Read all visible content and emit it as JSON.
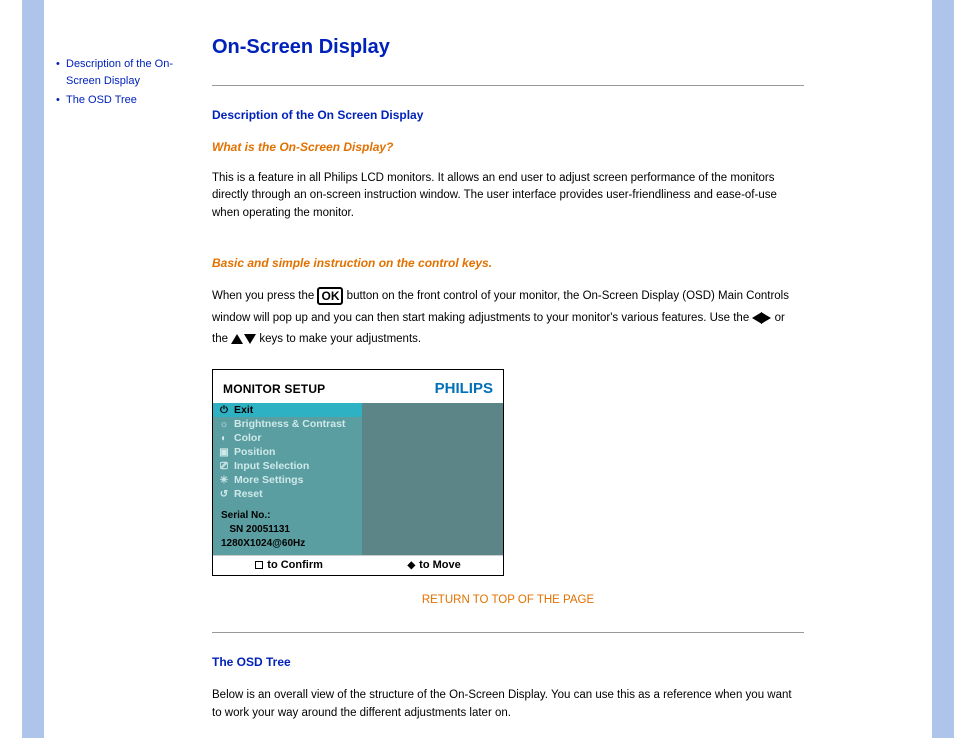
{
  "sidebar": {
    "items": [
      {
        "label": "Description of the On-Screen Display"
      },
      {
        "label": "The OSD Tree"
      }
    ]
  },
  "main": {
    "title": "On-Screen Display",
    "section1": {
      "heading": "Description of the On Screen Display",
      "sub1": "What is the On-Screen Display?",
      "para1": "This is a feature in all Philips LCD monitors. It allows an end user to adjust screen performance of the monitors directly through an on-screen instruction window. The user interface provides user-friendliness and ease-of-use when operating the monitor.",
      "sub2": "Basic and simple instruction on the control keys.",
      "instr_a": "When you press the ",
      "ok_label": "OK",
      "instr_b": " button on the front control of your monitor, the On-Screen Display (OSD) Main Controls window will pop up and you can then start making adjustments to your monitor's various features. Use the ",
      "instr_c": " or the ",
      "instr_d": " keys to make your adjustments."
    },
    "osd": {
      "setup_title": "MONITOR SETUP",
      "brand": "PHILIPS",
      "menu": [
        {
          "label": "Exit",
          "selected": true
        },
        {
          "label": "Brightness & Contrast",
          "selected": false
        },
        {
          "label": "Color",
          "selected": false
        },
        {
          "label": "Position",
          "selected": false
        },
        {
          "label": "Input Selection",
          "selected": false
        },
        {
          "label": "More Settings",
          "selected": false
        },
        {
          "label": "Reset",
          "selected": false
        }
      ],
      "serial_label": "Serial No.:",
      "serial_value": "   SN 20051131",
      "mode": "1280X1024@60Hz",
      "confirm": "to Confirm",
      "move": "to Move"
    },
    "return_link": "RETURN TO TOP OF THE PAGE",
    "section2": {
      "heading": "The OSD Tree",
      "para": "Below is an overall view of the structure of the On-Screen Display. You can use this as a reference when you want to work your way around the different adjustments later on."
    }
  }
}
